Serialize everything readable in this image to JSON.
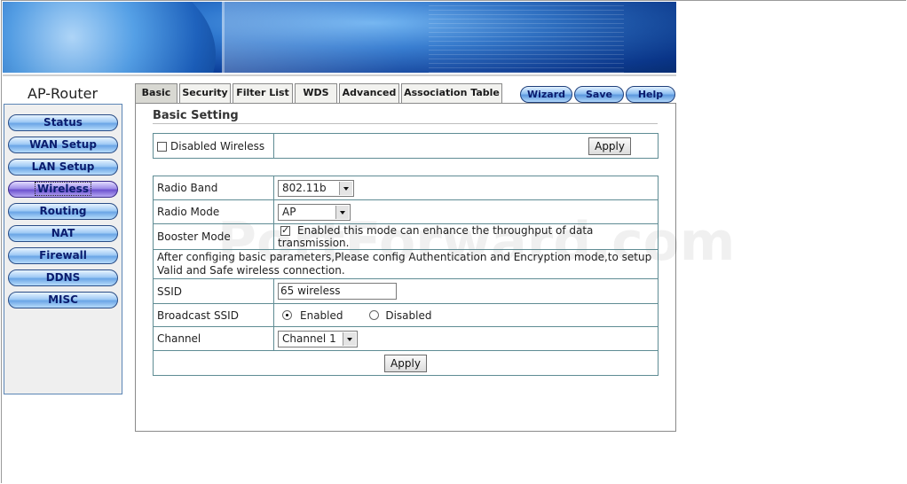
{
  "brand": "AP-Router",
  "sidebar": {
    "items": [
      {
        "label": "Status"
      },
      {
        "label": "WAN Setup"
      },
      {
        "label": "LAN Setup"
      },
      {
        "label": "Wireless"
      },
      {
        "label": "Routing"
      },
      {
        "label": "NAT"
      },
      {
        "label": "Firewall"
      },
      {
        "label": "DDNS"
      },
      {
        "label": "MISC"
      }
    ],
    "active": "Wireless"
  },
  "tabs": [
    "Basic",
    "Security",
    "Filter List",
    "WDS",
    "Advanced",
    "Association Table"
  ],
  "actions": {
    "wizard": "Wizard",
    "save": "Save",
    "help": "Help"
  },
  "basic_setting": {
    "title": "Basic Setting",
    "disable_wireless_label": "Disabled Wireless",
    "disable_wireless_checked": false,
    "apply_label": "Apply",
    "rows": {
      "radio_band": {
        "label": "Radio Band",
        "value": "802.11b"
      },
      "radio_mode": {
        "label": "Radio Mode",
        "value": "AP"
      },
      "booster_mode": {
        "label": "Booster Mode",
        "checked": true,
        "description": "Enabled this mode can enhance the throughput of data transmission."
      },
      "note": "After configing basic parameters,Please config Authentication and Encryption mode,to setup Valid and Safe wireless connection.",
      "ssid": {
        "label": "SSID",
        "value": "65 wireless"
      },
      "broadcast_ssid": {
        "label": "Broadcast SSID",
        "enabled_label": "Enabled",
        "disabled_label": "Disabled",
        "selected": "Enabled"
      },
      "channel": {
        "label": "Channel",
        "value": "Channel 1"
      }
    },
    "apply_bottom_label": "Apply"
  },
  "watermark": "PortForward.com"
}
